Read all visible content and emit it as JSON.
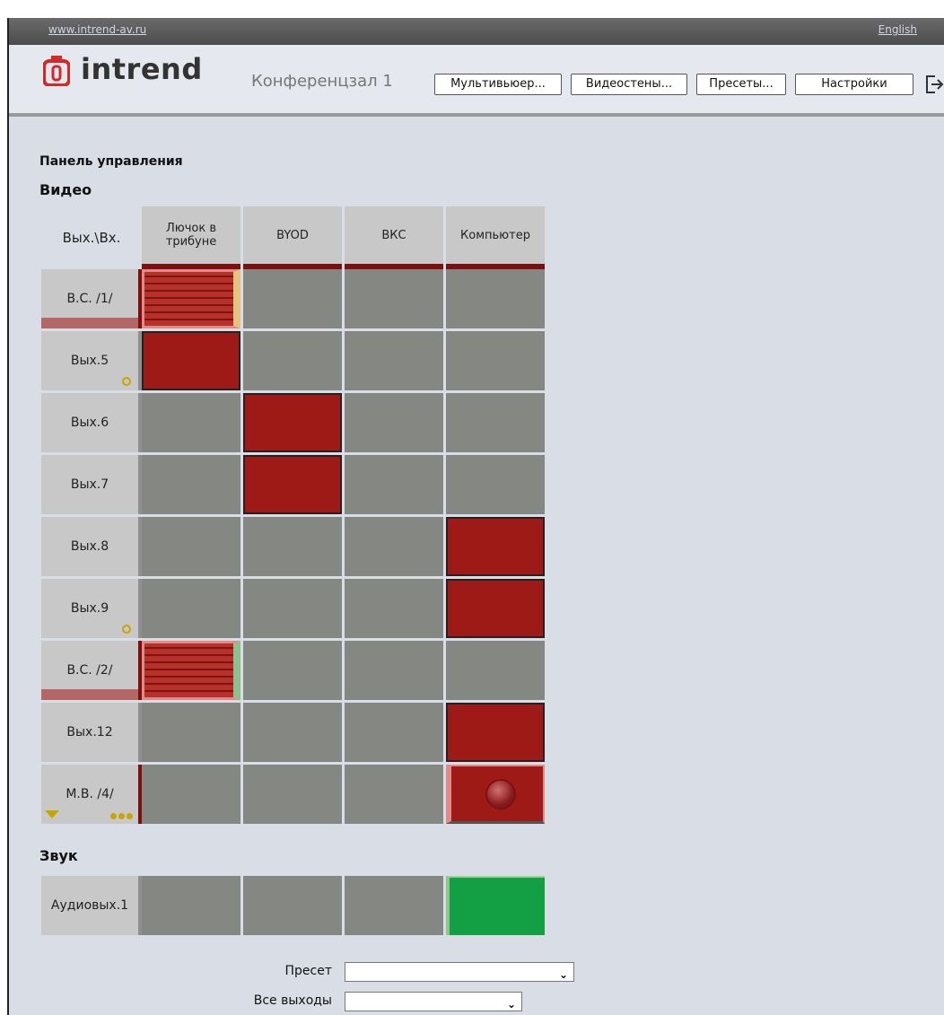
{
  "topbar": {
    "site_link": "www.intrend-av.ru",
    "language_link": "English"
  },
  "header": {
    "logo_text": "intrend",
    "room_title": "Конференцзал 1",
    "buttons": [
      "Мультивьюер...",
      "Видеостены...",
      "Пресеты...",
      "Настройки"
    ]
  },
  "panel_title": "Панель управления",
  "video": {
    "title": "Видео",
    "corner_label": "Вых.\\Вх.",
    "inputs": [
      "Лючок в трибуне",
      "BYOD",
      "ВКС",
      "Компьютер"
    ],
    "outputs": [
      "В.С. /1/",
      "Вых.5",
      "Вых.6",
      "Вых.7",
      "Вых.8",
      "Вых.9",
      "В.С. /2/",
      "Вых.12",
      "М.В. /4/"
    ],
    "routes": [
      [
        "brick",
        "off",
        "off",
        "off"
      ],
      [
        "on",
        "off",
        "off",
        "off"
      ],
      [
        "off",
        "on",
        "off",
        "off"
      ],
      [
        "off",
        "on",
        "off",
        "off"
      ],
      [
        "off",
        "off",
        "off",
        "on"
      ],
      [
        "off",
        "off",
        "off",
        "on"
      ],
      [
        "brick",
        "off",
        "off",
        "off"
      ],
      [
        "off",
        "off",
        "off",
        "on"
      ],
      [
        "off",
        "off",
        "off",
        "record"
      ]
    ]
  },
  "audio": {
    "title": "Звук",
    "outputs": [
      "Аудиовых.1"
    ],
    "routes": [
      [
        "off",
        "off",
        "off",
        "on"
      ]
    ]
  },
  "preset_label": "Пресет",
  "preset_value": "",
  "all_outputs_label": "Все выходы",
  "all_outputs_value": "",
  "colors": {
    "route_on": "#9e1a16",
    "cell_off": "#858782",
    "audio_on": "#13a045",
    "accent": "#7a1010"
  }
}
